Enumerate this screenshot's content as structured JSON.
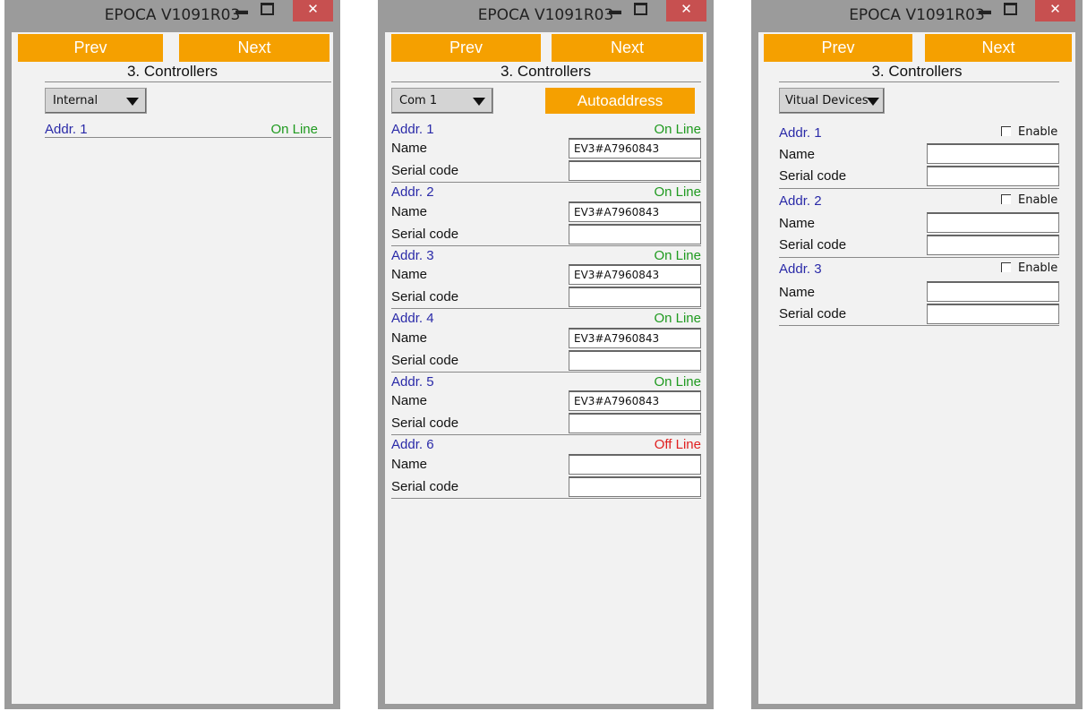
{
  "windows": [
    {
      "title": "EPOCA V1091R03",
      "prev_label": "Prev",
      "next_label": "Next",
      "heading": "3. Controllers",
      "combo_value": "Internal",
      "rows": [
        {
          "addr": "Addr. 1",
          "status": "On Line"
        }
      ]
    },
    {
      "title": "EPOCA V1091R03",
      "prev_label": "Prev",
      "next_label": "Next",
      "heading": "3. Controllers",
      "combo_value": "Com 1",
      "autoaddress_label": "Autoaddress",
      "name_label": "Name",
      "serial_label": "Serial code",
      "rows": [
        {
          "addr": "Addr. 1",
          "status": "On Line",
          "name": "EV3#A7960843",
          "serial": ""
        },
        {
          "addr": "Addr. 2",
          "status": "On Line",
          "name": "EV3#A7960843",
          "serial": ""
        },
        {
          "addr": "Addr. 3",
          "status": "On Line",
          "name": "EV3#A7960843",
          "serial": ""
        },
        {
          "addr": "Addr. 4",
          "status": "On Line",
          "name": "EV3#A7960843",
          "serial": ""
        },
        {
          "addr": "Addr. 5",
          "status": "On Line",
          "name": "EV3#A7960843",
          "serial": ""
        },
        {
          "addr": "Addr. 6",
          "status": "Off Line",
          "name": "",
          "serial": ""
        }
      ]
    },
    {
      "title": "EPOCA V1091R03",
      "prev_label": "Prev",
      "next_label": "Next",
      "heading": "3. Controllers",
      "combo_value": "Vitual Devices",
      "name_label": "Name",
      "serial_label": "Serial code",
      "enable_label": "Enable",
      "rows": [
        {
          "addr": "Addr. 1",
          "enabled": false,
          "name": "",
          "serial": ""
        },
        {
          "addr": "Addr. 2",
          "enabled": false,
          "name": "",
          "serial": ""
        },
        {
          "addr": "Addr. 3",
          "enabled": false,
          "name": "",
          "serial": ""
        }
      ]
    }
  ],
  "icons": {
    "minimize": "minimize-icon",
    "maximize": "maximize-icon",
    "close": "close-icon",
    "dropdown": "dropdown-arrow-icon"
  },
  "colors": {
    "accent": "#f5a000",
    "online": "#1f9a1f",
    "offline": "#e02020",
    "addr": "#2a2aa8",
    "close_button": "#c75050"
  }
}
